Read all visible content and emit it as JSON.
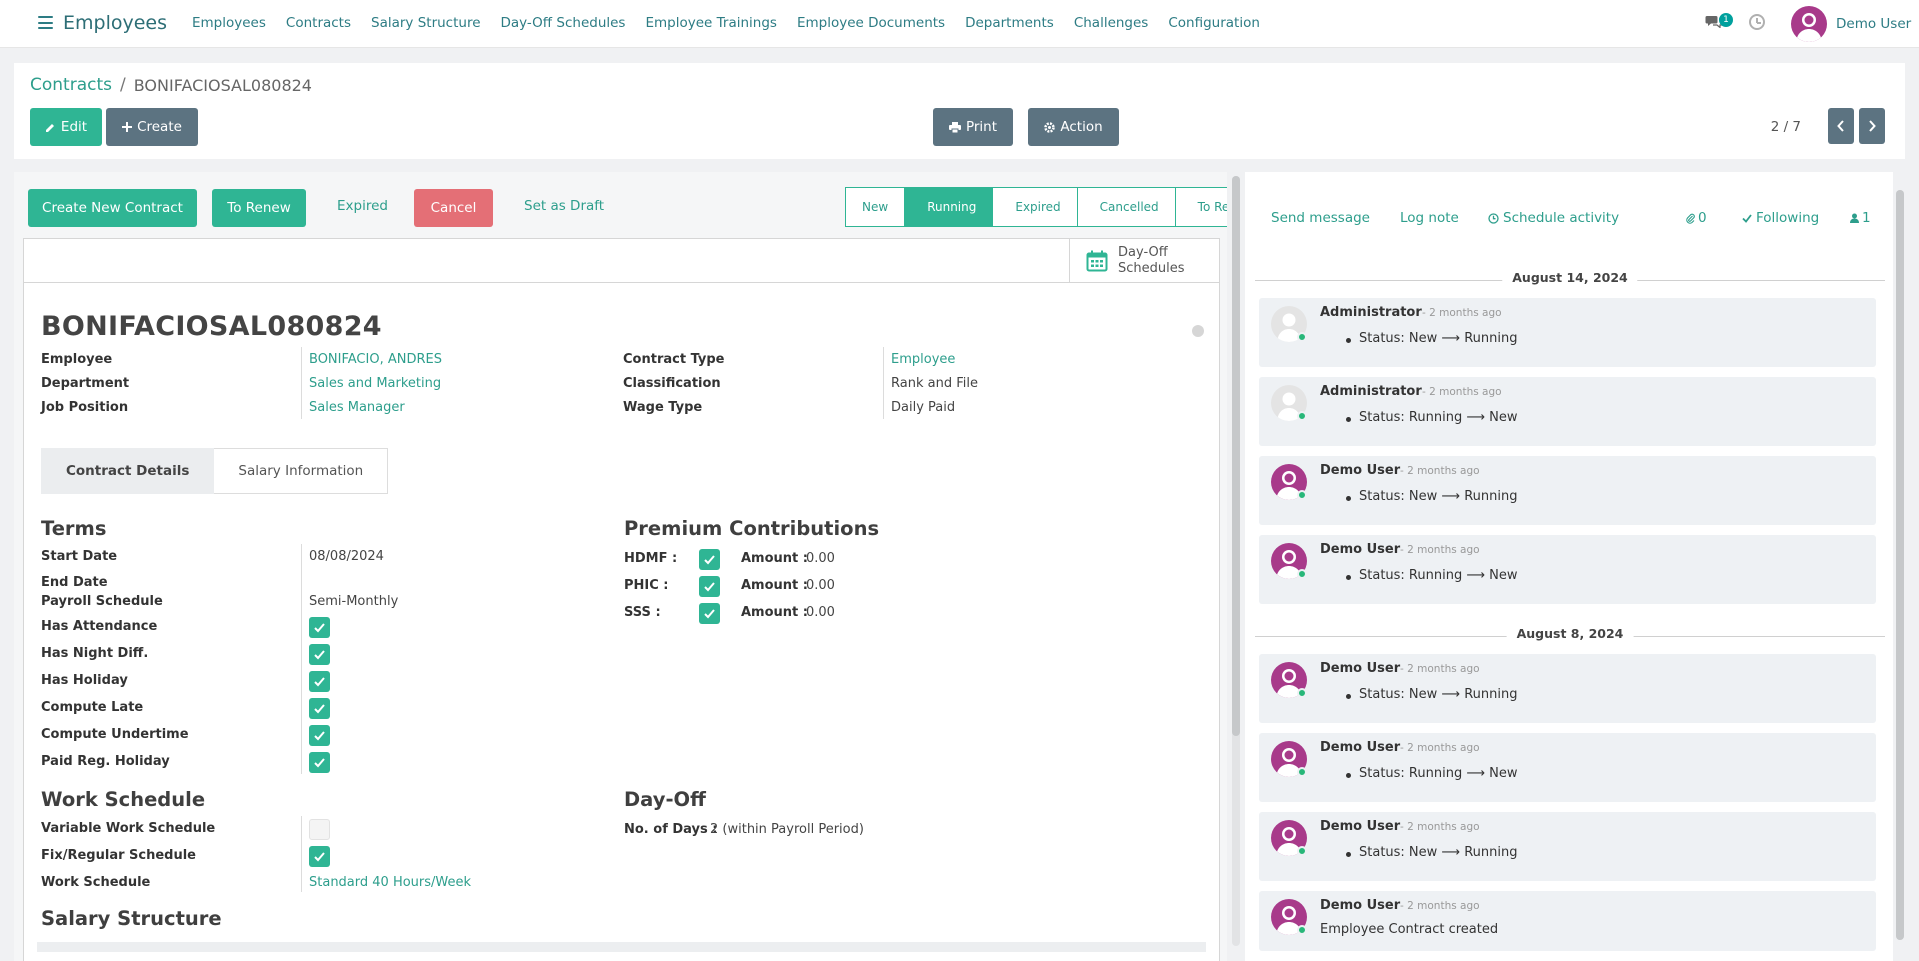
{
  "nav": {
    "brand": "Employees",
    "items": [
      "Employees",
      "Contracts",
      "Salary Structure",
      "Day-Off Schedules",
      "Employee Trainings",
      "Employee Documents",
      "Departments",
      "Challenges",
      "Configuration"
    ],
    "chat_count": "1",
    "user": "Demo User"
  },
  "breadcrumb": {
    "parent": "Contracts",
    "current": "BONIFACIOSAL080824"
  },
  "toolbar": {
    "edit": "Edit",
    "create": "Create",
    "print": "Print",
    "action": "Action",
    "pager": "2 / 7"
  },
  "statusbar": {
    "buttons": {
      "create_new": "Create New Contract",
      "to_renew": "To Renew",
      "expired": "Expired",
      "cancel": "Cancel",
      "set_draft": "Set as Draft"
    },
    "stages": [
      "New",
      "Running",
      "Expired",
      "Cancelled",
      "To Renew"
    ],
    "active_stage": "Running"
  },
  "smart_button": {
    "label_line1": "Day-Off",
    "label_line2": "Schedules"
  },
  "record": {
    "title": "BONIFACIOSAL080824",
    "employee_label": "Employee",
    "employee": "BONIFACIO, ANDRES",
    "department_label": "Department",
    "department": "Sales and Marketing",
    "job_label": "Job Position",
    "job": "Sales Manager",
    "contract_type_label": "Contract Type",
    "contract_type": "Employee",
    "classification_label": "Classification",
    "classification": "Rank and File",
    "wage_type_label": "Wage Type",
    "wage_type": "Daily Paid"
  },
  "tabs": [
    "Contract Details",
    "Salary Information"
  ],
  "terms": {
    "heading": "Terms",
    "start_label": "Start Date",
    "start": "08/08/2024",
    "end_label": "End Date",
    "payroll_label": "Payroll Schedule",
    "payroll": "Semi-Monthly",
    "flags": [
      "Has Attendance",
      "Has Night Diff.",
      "Has Holiday",
      "Compute Late",
      "Compute Undertime",
      "Paid Reg. Holiday"
    ]
  },
  "premium": {
    "heading": "Premium Contributions",
    "rows": [
      {
        "label": "HDMF :",
        "amount_label": "Amount :",
        "amount": "0.00"
      },
      {
        "label": "PHIC :",
        "amount_label": "Amount :",
        "amount": "0.00"
      },
      {
        "label": "SSS :",
        "amount_label": "Amount :",
        "amount": "0.00"
      }
    ]
  },
  "work_schedule": {
    "heading": "Work Schedule",
    "variable_label": "Variable Work Schedule",
    "fixed_label": "Fix/Regular Schedule",
    "schedule_label": "Work Schedule",
    "schedule": "Standard 40 Hours/Week"
  },
  "dayoff": {
    "heading": "Day-Off",
    "days_label": "No. of Days :",
    "days": "2 (within Payroll Period)"
  },
  "salary_structure": {
    "heading": "Salary Structure"
  },
  "chatter": {
    "send_message": "Send message",
    "log_note": "Log note",
    "schedule_activity": "Schedule activity",
    "attachments": "0",
    "following": "Following",
    "followers": "1",
    "date1": "August 14, 2024",
    "date2": "August 8, 2024",
    "messages": [
      {
        "author": "Administrator",
        "date": "- 2 months ago",
        "body": "Status: New ⟶ Running"
      },
      {
        "author": "Administrator",
        "date": "- 2 months ago",
        "body": "Status: Running ⟶ New"
      },
      {
        "author": "Demo User",
        "date": "- 2 months ago",
        "body": "Status: New ⟶ Running"
      },
      {
        "author": "Demo User",
        "date": "- 2 months ago",
        "body": "Status: Running ⟶ New"
      },
      {
        "author": "Demo User",
        "date": "- 2 months ago",
        "body": "Status: New ⟶ Running"
      },
      {
        "author": "Demo User",
        "date": "- 2 months ago",
        "body": "Status: Running ⟶ New"
      },
      {
        "author": "Demo User",
        "date": "- 2 months ago",
        "body": "Status: New ⟶ Running"
      },
      {
        "author": "Demo User",
        "date": "- 2 months ago",
        "body": "Employee Contract created"
      }
    ]
  },
  "colors": {
    "primary": "#2fb594",
    "secondary": "#5c7381",
    "danger": "#e46f76",
    "link": "#2d9e8c"
  }
}
